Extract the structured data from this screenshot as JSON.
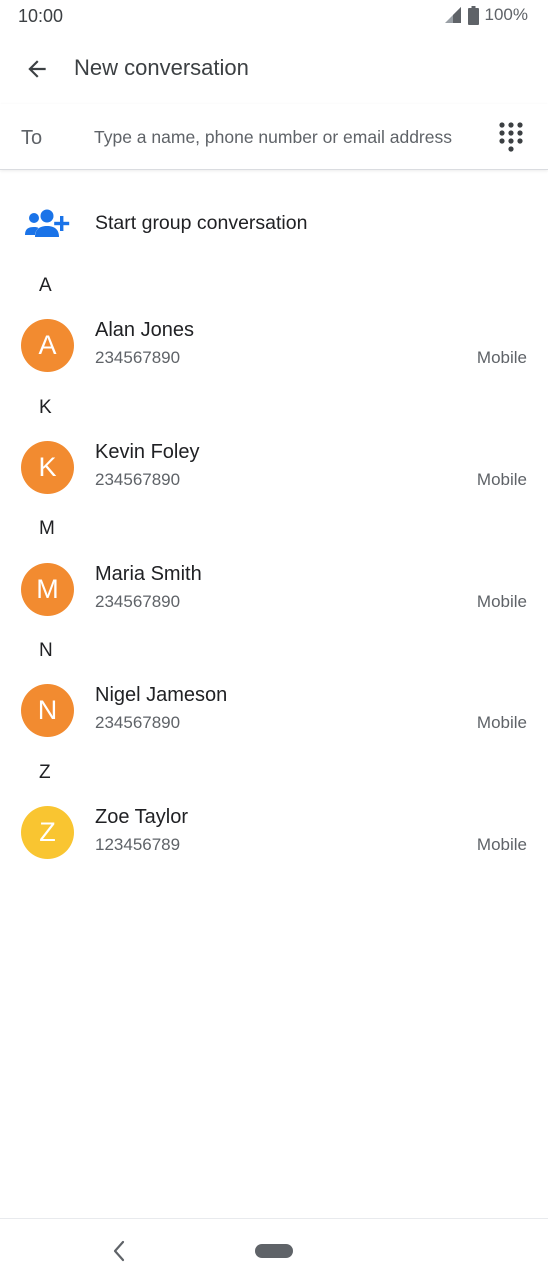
{
  "status_bar": {
    "time": "10:00",
    "battery": "100%"
  },
  "app_bar": {
    "title": "New conversation"
  },
  "recipient": {
    "label": "To",
    "placeholder": "Type a name, phone number or email address"
  },
  "group": {
    "label": "Start group conversation"
  },
  "colors": {
    "accent": "#1a73e8",
    "avatar_orange": "#f28b30",
    "avatar_yellow": "#f9c531"
  },
  "sections": [
    {
      "letter": "A",
      "contact": {
        "initial": "A",
        "name": "Alan Jones",
        "number": "234567890",
        "type": "Mobile"
      }
    },
    {
      "letter": "K",
      "contact": {
        "initial": "K",
        "name": "Kevin Foley",
        "number": "234567890",
        "type": "Mobile"
      }
    },
    {
      "letter": "M",
      "contact": {
        "initial": "M",
        "name": "Maria Smith",
        "number": "234567890",
        "type": "Mobile"
      }
    },
    {
      "letter": "N",
      "contact": {
        "initial": "N",
        "name": "Nigel Jameson",
        "number": "234567890",
        "type": "Mobile"
      }
    },
    {
      "letter": "Z",
      "contact": {
        "initial": "Z",
        "name": "Zoe Taylor",
        "number": "123456789",
        "type": "Mobile"
      }
    }
  ]
}
